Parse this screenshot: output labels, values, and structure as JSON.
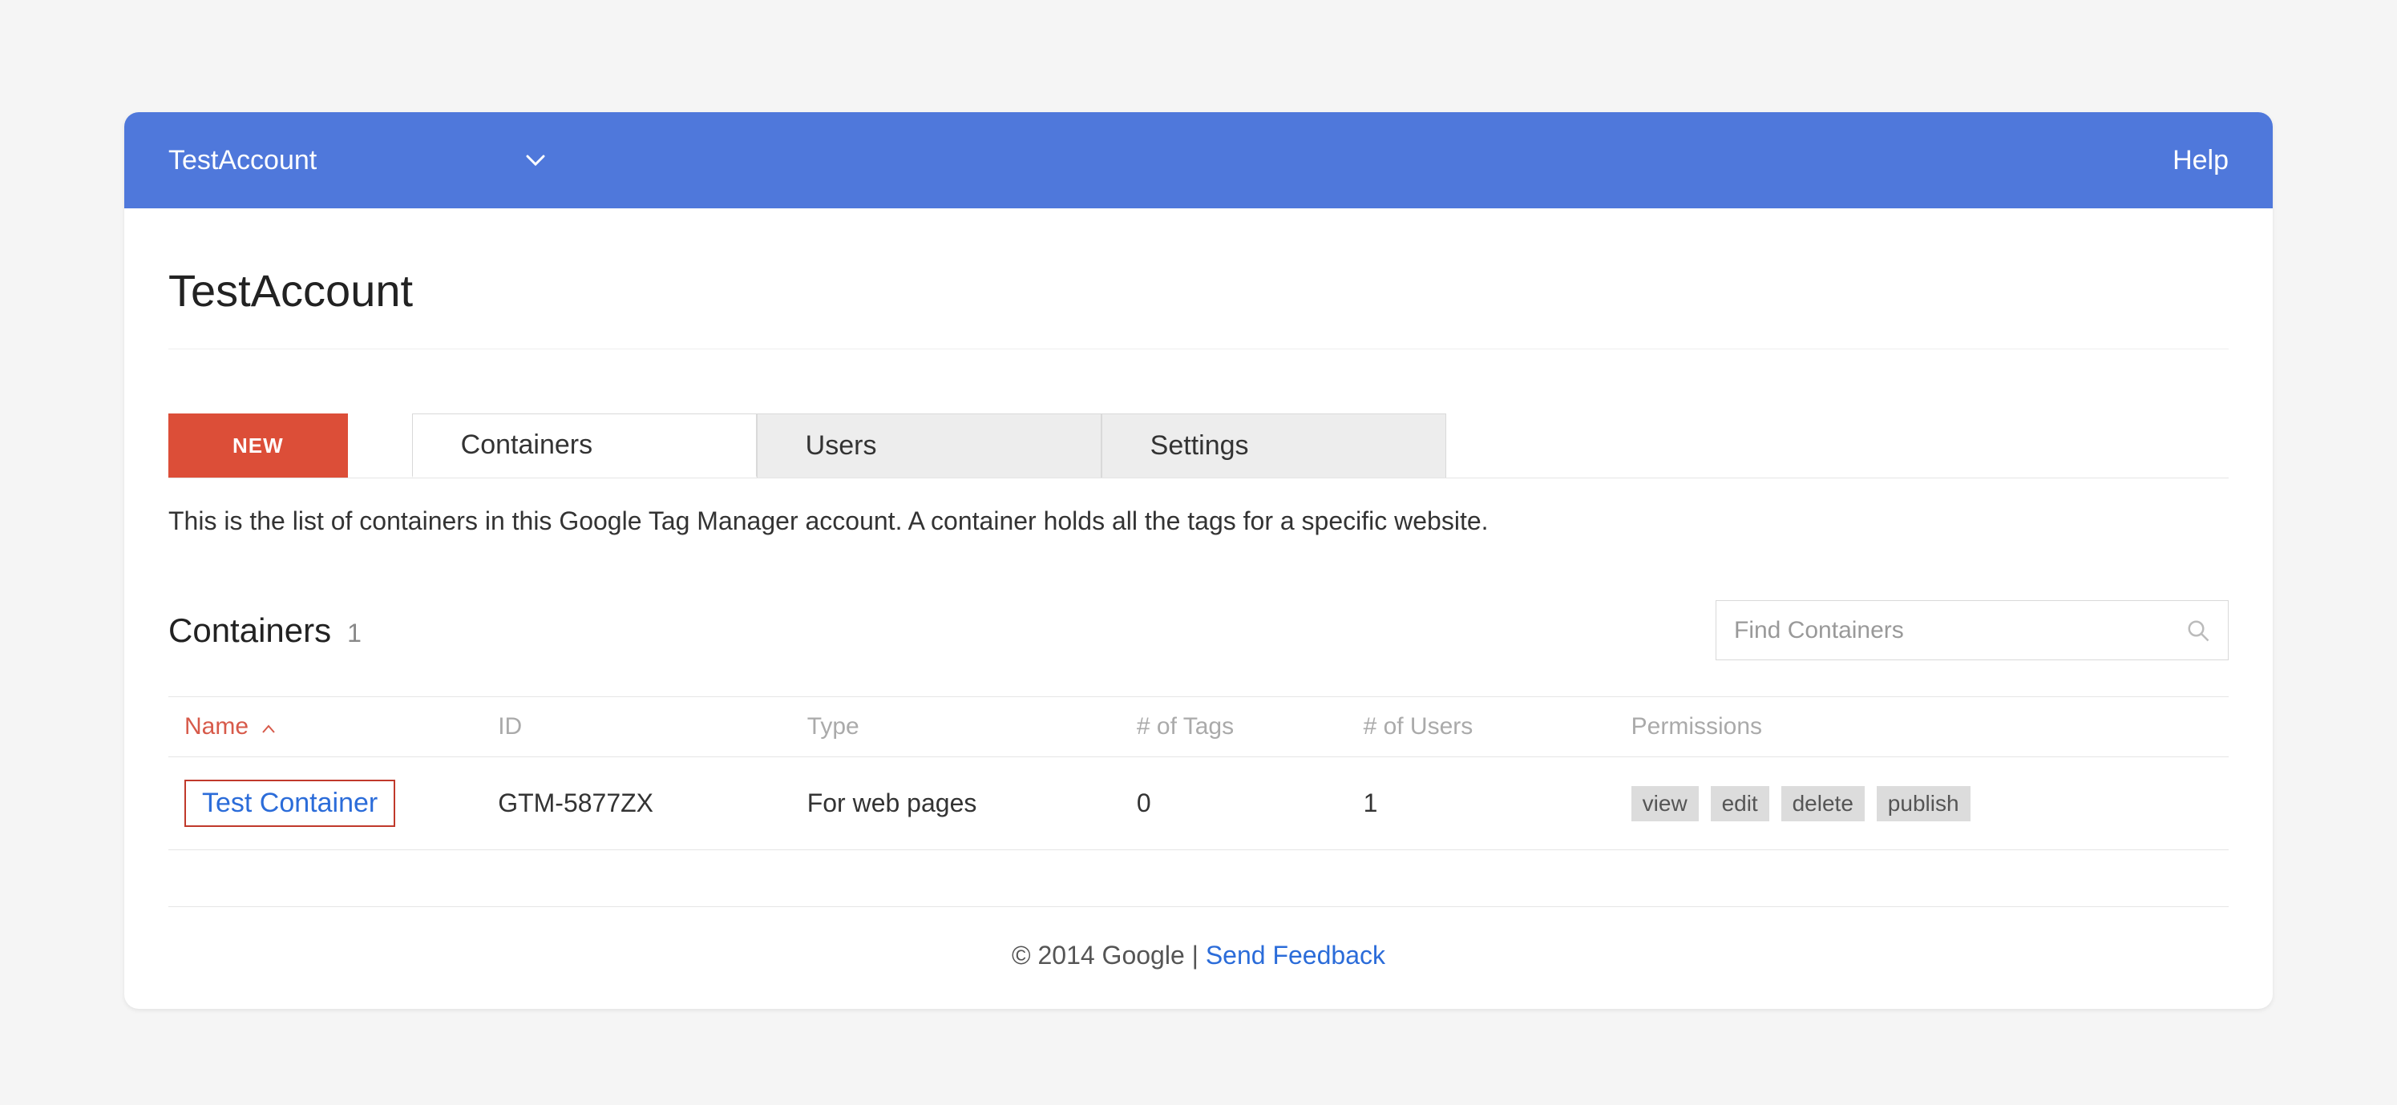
{
  "topbar": {
    "account_name": "TestAccount",
    "help": "Help"
  },
  "page": {
    "title": "TestAccount",
    "new_button": "NEW",
    "tabs": {
      "containers": "Containers",
      "users": "Users",
      "settings": "Settings"
    },
    "description": "This is the list of containers in this Google Tag Manager account. A container holds all the tags for a specific website."
  },
  "list": {
    "title": "Containers",
    "count": "1",
    "search_placeholder": "Find Containers"
  },
  "table": {
    "headers": {
      "name": "Name",
      "id": "ID",
      "type": "Type",
      "tags": "# of Tags",
      "users": "# of Users",
      "permissions": "Permissions"
    },
    "row": {
      "name": "Test Container",
      "id": "GTM-5877ZX",
      "type": "For web pages",
      "tags": "0",
      "users": "1",
      "permissions": {
        "view": "view",
        "edit": "edit",
        "delete": "delete",
        "publish": "publish"
      }
    }
  },
  "footer": {
    "copyright": "© 2014 Google",
    "divider": " | ",
    "feedback": "Send Feedback"
  }
}
